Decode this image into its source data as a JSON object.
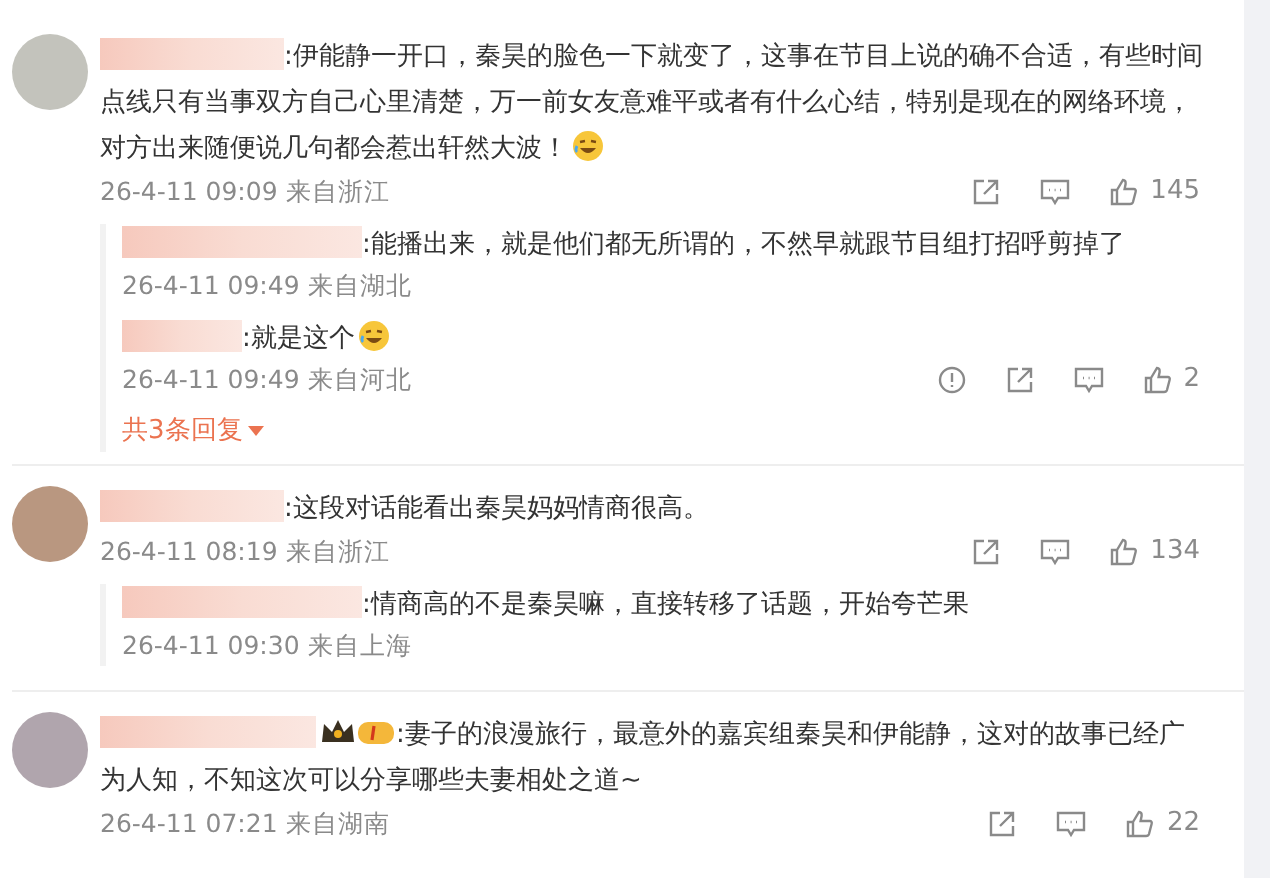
{
  "comments": [
    {
      "text": ":伊能静一开口，秦昊的脸色一下就变了，这事在节目上说的确不合适，有些时间点线只有当事双方自己心里清楚，万一前女友意难平或者有什么心结，特别是现在的网络环境，对方出来随便说几句都会惹出轩然大波！",
      "laugh_emoji": true,
      "time": "26-4-11 09:09",
      "location": "来自浙江",
      "likes": "145",
      "replies": [
        {
          "text": ":能播出来，就是他们都无所谓的，不然早就跟节目组打招呼剪掉了",
          "time": "26-4-11 09:49",
          "location": "来自湖北"
        },
        {
          "text": ":就是这个",
          "laugh_emoji": true,
          "time": "26-4-11 09:49",
          "location": "来自河北",
          "report": true,
          "likes": "2"
        }
      ],
      "more_replies": "共3条回复"
    },
    {
      "text": ":这段对话能看出秦昊妈妈情商很高。",
      "time": "26-4-11 08:19",
      "location": "来自浙江",
      "likes": "134",
      "replies": [
        {
          "text": ":情商高的不是秦昊嘛，直接转移了话题，开始夸芒果",
          "time": "26-4-11 09:30",
          "location": "来自上海"
        }
      ]
    },
    {
      "text": ":妻子的浪漫旅行，最意外的嘉宾组秦昊和伊能静，这对的故事已经广为人知，不知这次可以分享哪些夫妻相处之道~",
      "badge": true,
      "time": "26-4-11 07:21",
      "location": "来自湖南",
      "likes": "22"
    }
  ]
}
